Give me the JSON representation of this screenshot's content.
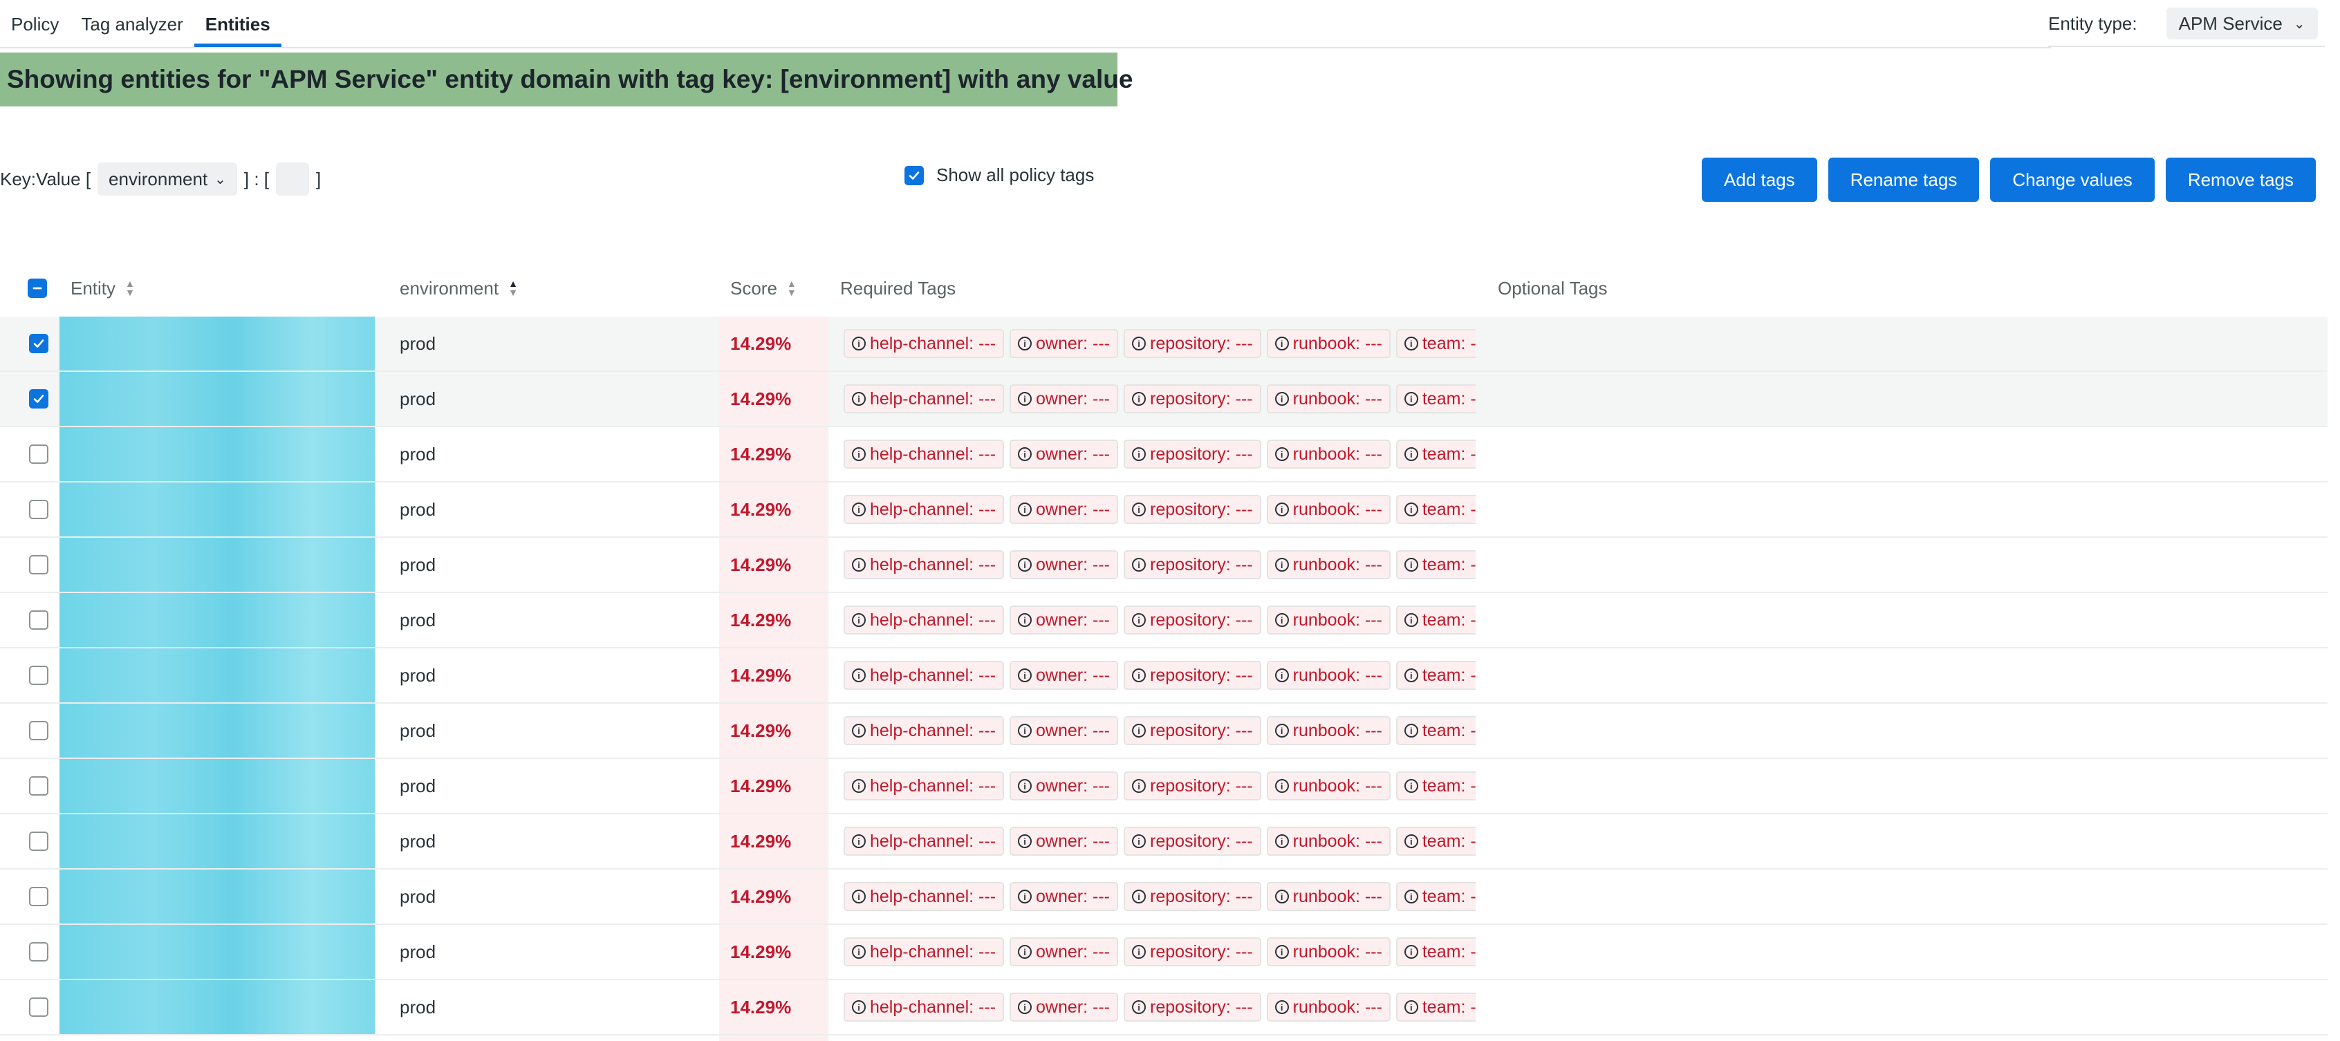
{
  "tabs": [
    {
      "label": "Policy",
      "active": false
    },
    {
      "label": "Tag analyzer",
      "active": false
    },
    {
      "label": "Entities",
      "active": true
    }
  ],
  "entity_type": {
    "label": "Entity type:",
    "value": "APM Service"
  },
  "banner": {
    "text": "Showing entities for \"APM Service\" entity domain with tag key: [environment] with any value",
    "color": "#8fbc8f"
  },
  "filter": {
    "prefix": "Key:Value [",
    "key_value": "environment",
    "separator": "] : [",
    "suffix": "]"
  },
  "show_all": {
    "label": "Show all policy tags",
    "checked": true
  },
  "actions": {
    "add": "Add tags",
    "rename": "Rename tags",
    "change": "Change values",
    "remove": "Remove tags"
  },
  "columns": {
    "entity": "Entity",
    "environment": "environment",
    "score": "Score",
    "required": "Required Tags",
    "optional": "Optional Tags"
  },
  "required_tags": [
    "help-channel: ---",
    "owner: ---",
    "repository: ---",
    "runbook: ---",
    "team: ---"
  ],
  "rows": [
    {
      "checked": true,
      "environment": "prod",
      "score": "14.29%"
    },
    {
      "checked": true,
      "environment": "prod",
      "score": "14.29%"
    },
    {
      "checked": false,
      "environment": "prod",
      "score": "14.29%"
    },
    {
      "checked": false,
      "environment": "prod",
      "score": "14.29%"
    },
    {
      "checked": false,
      "environment": "prod",
      "score": "14.29%"
    },
    {
      "checked": false,
      "environment": "prod",
      "score": "14.29%"
    },
    {
      "checked": false,
      "environment": "prod",
      "score": "14.29%"
    },
    {
      "checked": false,
      "environment": "prod",
      "score": "14.29%"
    },
    {
      "checked": false,
      "environment": "prod",
      "score": "14.29%"
    },
    {
      "checked": false,
      "environment": "prod",
      "score": "14.29%"
    },
    {
      "checked": false,
      "environment": "prod",
      "score": "14.29%"
    },
    {
      "checked": false,
      "environment": "prod",
      "score": "14.29%"
    },
    {
      "checked": false,
      "environment": "prod",
      "score": "14.29%"
    }
  ],
  "colors": {
    "accent": "#0c74df",
    "danger": "#c0182b",
    "score_bg": "#fdeef0"
  }
}
